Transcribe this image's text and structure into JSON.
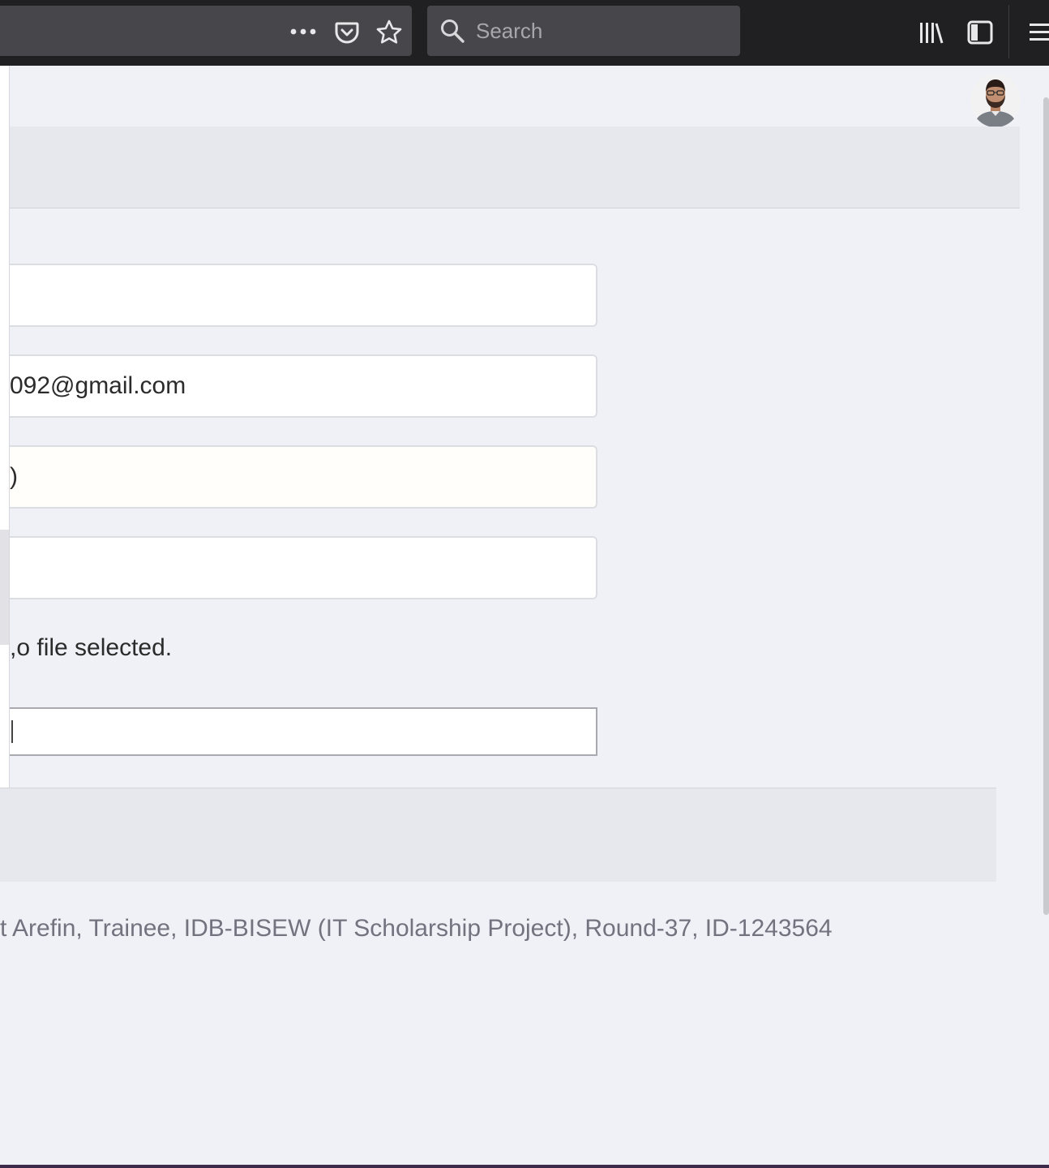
{
  "browser": {
    "search_placeholder": "Search"
  },
  "form": {
    "email_value": "092@gmail.com",
    "field3_value": ")",
    "file_status_cut": ",",
    "file_status": "o file selected."
  },
  "footer": {
    "credits": "t Arefin, Trainee, IDB-BISEW (IT Scholarship Project), Round-37, ID-1243564"
  },
  "icons": {
    "more": "more-horizontal-icon",
    "pocket": "pocket-icon",
    "bookmark": "star-icon",
    "search": "search-icon",
    "library": "library-icon",
    "sidebar": "sidebar-icon",
    "menu": "hamburger-menu-icon"
  },
  "colors": {
    "toolbar_bg": "#202023",
    "urlbar_bg": "#46464b",
    "page_bg": "#f0f1f6",
    "band_bg": "#e7e8ed",
    "credit_text": "#737380"
  }
}
